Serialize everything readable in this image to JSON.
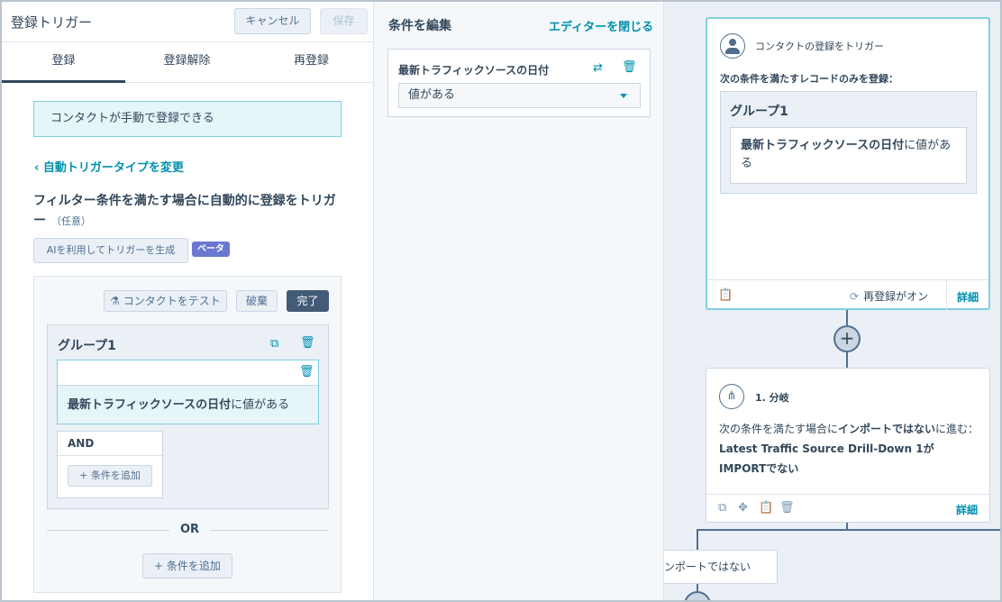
{
  "header": {
    "title": "登録トリガー",
    "cancel_label": "キャンセル",
    "save_label": "保存"
  },
  "tabs": [
    {
      "label": "登録"
    },
    {
      "label": "登録解除"
    },
    {
      "label": "再登録"
    }
  ],
  "notice": "コンタクトが手動で登録できる",
  "change_trigger_link": "‹ 自動トリガータイプを変更",
  "filter_heading": "フィルター条件を満たす場合に自動的に登録をトリガー",
  "filter_optional": "（任意）",
  "ai_button": "AIを利用してトリガーを生成",
  "beta_badge": "ベータ",
  "filter": {
    "test_label": "コンタクトをテスト",
    "discard_label": "破棄",
    "done_label": "完了",
    "group_title": "グループ1",
    "condition_property": "最新トラフィックソースの日付",
    "condition_operator": "に値がある",
    "and_label": "AND",
    "add_condition_label": "条件を追加",
    "or_label": "OR",
    "add_condition_label_2": "条件を追加"
  },
  "editor": {
    "title": "条件を編集",
    "close_label": "エディターを閉じる",
    "property": "最新トラフィックソースの日付",
    "operator_value": "値がある"
  },
  "workflow": {
    "trigger_card": {
      "title": "コンタクトの登録をトリガー",
      "subtitle": "次の条件を満たすレコードのみを登録：",
      "group_title": "グループ1",
      "condition_bold": "最新トラフィックソースの日付",
      "condition_rest": "に値がある",
      "reenroll_status": "再登録がオン",
      "details_label": "詳細"
    },
    "branch_card": {
      "title": "1. 分岐",
      "body_part1": "次の条件を満たす場合に",
      "body_bold1": "インポートではない",
      "body_part2": "に進む：",
      "body_bold2": "Latest Traffic Source Drill-Down 1がIMPORTでない",
      "details_label": "詳細"
    },
    "branch_label": "ンポートではない"
  },
  "colors": {
    "accent": "#0091ae",
    "dark": "#33475b",
    "beta": "#6a78d1",
    "canvas": "#eaf0f6"
  }
}
